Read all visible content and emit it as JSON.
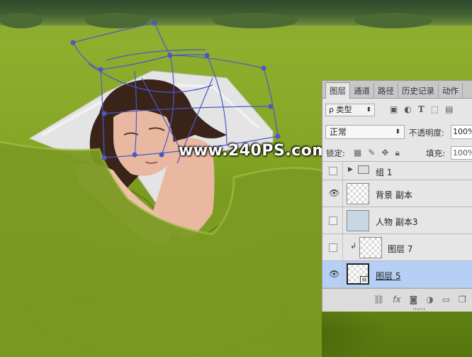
{
  "watermark": "www.240PS.com",
  "panel": {
    "tabs": [
      "图层",
      "通道",
      "路径",
      "历史记录",
      "动作"
    ],
    "active_tab": 0,
    "filter": {
      "label": "ρ 类型",
      "icons": [
        "image-filter-icon",
        "adjustment-filter-icon",
        "type-filter-icon",
        "shape-filter-icon",
        "smart-object-filter-icon"
      ]
    },
    "blend_mode": "正常",
    "opacity_label": "不透明度:",
    "opacity_value": "100%",
    "lock_label": "锁定:",
    "lock_icons": [
      "lock-transparent-icon",
      "lock-paint-icon",
      "lock-move-icon",
      "lock-all-icon"
    ],
    "fill_label": "填充:",
    "fill_value": "100%",
    "layers": [
      {
        "name": "组 1",
        "visible": false,
        "type": "group"
      },
      {
        "name": "背景 副本",
        "visible": true,
        "type": "layer"
      },
      {
        "name": "人物 副本3",
        "visible": false,
        "type": "layer"
      },
      {
        "name": "图层 7",
        "visible": false,
        "type": "clipped"
      },
      {
        "name": "图层 5",
        "visible": true,
        "type": "smart-object",
        "selected": true
      }
    ],
    "bottom_icons": [
      "link-icon",
      "fx-icon",
      "mask-icon",
      "adjustment-icon",
      "new-group-icon",
      "new-layer-icon",
      "trash-icon"
    ]
  }
}
